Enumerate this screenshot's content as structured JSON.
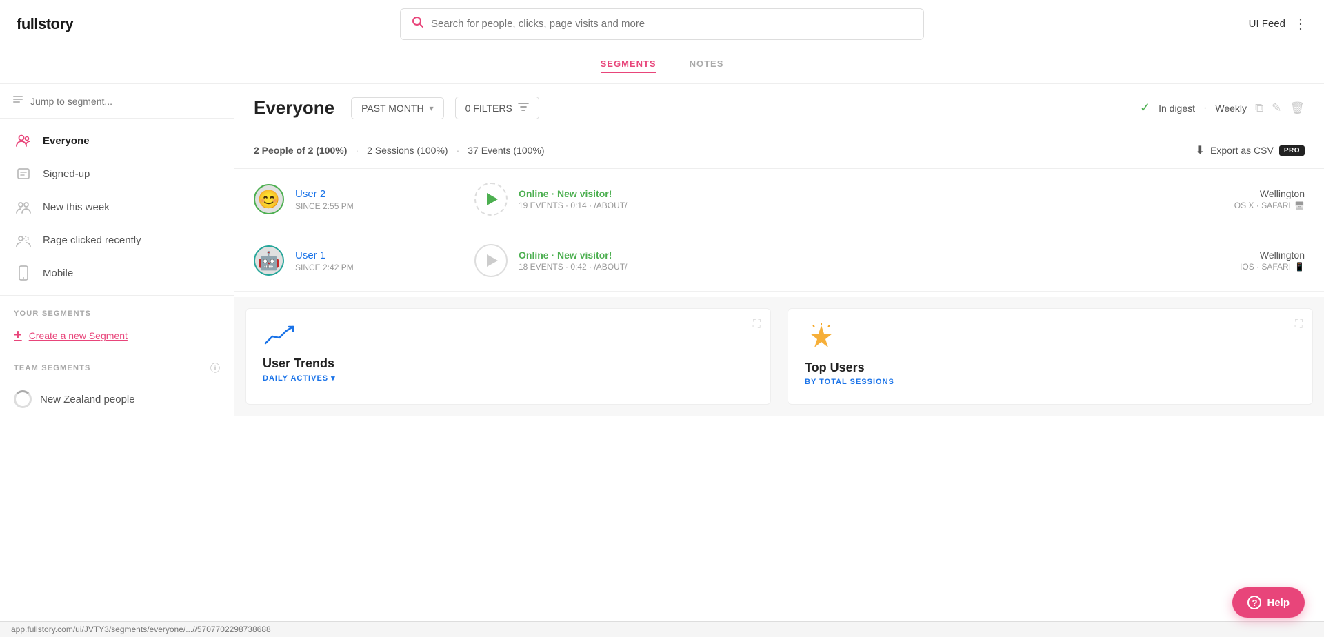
{
  "app": {
    "logo": "fullstory",
    "user_label": "UI Feed",
    "search_placeholder": "Search for people, clicks, page visits and more"
  },
  "nav": {
    "tabs": [
      {
        "id": "segments",
        "label": "SEGMENTS",
        "active": true
      },
      {
        "id": "notes",
        "label": "NOTES",
        "active": false
      }
    ]
  },
  "sidebar": {
    "search_placeholder": "Jump to segment...",
    "nav_items": [
      {
        "id": "everyone",
        "label": "Everyone",
        "active": true,
        "icon": "👤"
      },
      {
        "id": "signed-up",
        "label": "Signed-up",
        "active": false,
        "icon": "📋"
      },
      {
        "id": "new-this-week",
        "label": "New this week",
        "active": false,
        "icon": "👥"
      },
      {
        "id": "rage-clicked",
        "label": "Rage clicked recently",
        "active": false,
        "icon": "😤"
      },
      {
        "id": "mobile",
        "label": "Mobile",
        "active": false,
        "icon": "📱"
      }
    ],
    "your_segments_label": "YOUR SEGMENTS",
    "create_segment_label": "Create a new Segment",
    "team_segments_label": "TEAM SEGMENTS",
    "team_segments": [
      {
        "id": "new-zealand",
        "label": "New Zealand people"
      }
    ]
  },
  "segment": {
    "title": "Everyone",
    "time_filter": "PAST MONTH",
    "filter_count": "0 FILTERS",
    "digest_label": "In digest",
    "digest_separator": "·",
    "digest_frequency": "Weekly",
    "stats": {
      "people": "2 People of 2 (100%)",
      "sessions": "2 Sessions (100%)",
      "events": "37 Events (100%)"
    },
    "export_label": "Export as CSV",
    "pro_badge": "PRO"
  },
  "users": [
    {
      "id": "user2",
      "name": "User 2",
      "since": "SINCE 2:55 PM",
      "status": "Online",
      "status_detail": "New visitor!",
      "events": "19 EVENTS",
      "duration": "0:14",
      "path": "/ABOUT/",
      "city": "Wellington",
      "os": "OS X · SAFARI",
      "avatar_emoji": "😊",
      "avatar_color": "green"
    },
    {
      "id": "user1",
      "name": "User 1",
      "since": "SINCE 2:42 PM",
      "status": "Online",
      "status_detail": "New visitor!",
      "events": "18 EVENTS",
      "duration": "0:42",
      "path": "/ABOUT/",
      "city": "Wellington",
      "os": "IOS · SAFARI",
      "avatar_emoji": "🤖",
      "avatar_color": "teal"
    }
  ],
  "charts": [
    {
      "id": "user-trends",
      "title": "User Trends",
      "subtitle": "DAILY ACTIVES",
      "icon": "📈",
      "icon_color": "#1a73e8"
    },
    {
      "id": "top-users",
      "title": "Top Users",
      "subtitle": "BY TOTAL SESSIONS",
      "icon": "👑",
      "icon_color": "#f5a623"
    }
  ],
  "help_button": {
    "label": "Help",
    "icon": "?"
  },
  "status_bar": {
    "url": "app.fullstory.com/ui/JVTY3/segments/everyone/...//5707702298738688"
  }
}
